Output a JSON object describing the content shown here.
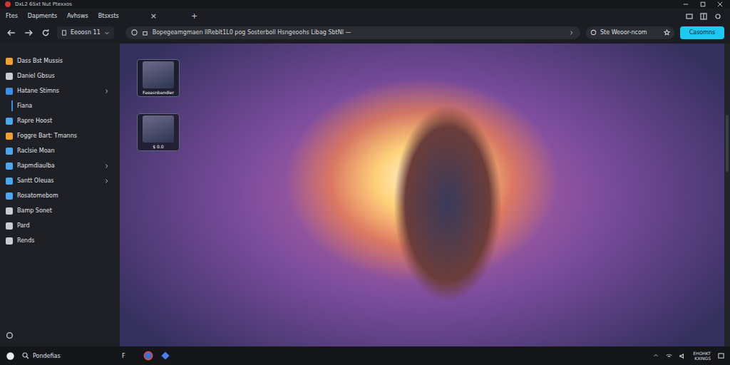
{
  "window": {
    "title": "DxL2 6Sxt Nut Ptexxos"
  },
  "menu": [
    "Ftes",
    "Dapments",
    "Avhsws",
    "Btsxsts"
  ],
  "tab_controls": {
    "close": "×",
    "new": "+"
  },
  "nav": {
    "tab_label": "Eeoosn 11",
    "address": "Bopegeamgmaen llReblt1L0 pog Sosterboll Hsngeoohs Libag SbtNl —",
    "search": "Ste Weoor-ncom",
    "button": "Casomns"
  },
  "sidebar": {
    "items": [
      {
        "label": "Dass Bst Mussis",
        "kind": "item",
        "expandable": false,
        "color": "#f0a030"
      },
      {
        "label": "Daniel Gbsus",
        "kind": "item",
        "expandable": false,
        "color": "#c8ccd4"
      },
      {
        "label": "Hatane Stimns",
        "kind": "item",
        "expandable": true,
        "color": "#3a8ee8"
      },
      {
        "label": "Fiana",
        "kind": "child",
        "expandable": false,
        "color": "#3a8ee8"
      },
      {
        "label": "Rapre Hoost",
        "kind": "item",
        "expandable": false,
        "color": "#4aa8f0"
      },
      {
        "label": "Foggre Bart: Tmanns",
        "kind": "item",
        "expandable": false,
        "color": "#f0a030"
      },
      {
        "label": "Raclsie Moan",
        "kind": "item",
        "expandable": false,
        "color": "#4aa8f0"
      },
      {
        "label": "Rapmdiaulba",
        "kind": "item",
        "expandable": true,
        "color": "#4aa8f0"
      },
      {
        "label": "Santt Oleuas",
        "kind": "item",
        "expandable": true,
        "color": "#4aa8f0"
      },
      {
        "label": "Rosatomebom",
        "kind": "item",
        "expandable": false,
        "color": "#4aa8f0"
      },
      {
        "label": "Bamp Sonet",
        "kind": "item",
        "expandable": false,
        "color": "#c8ccd4"
      },
      {
        "label": "Pard",
        "kind": "item",
        "expandable": false,
        "color": "#c8ccd4"
      },
      {
        "label": "Rends",
        "kind": "item",
        "expandable": false,
        "color": "#c8ccd4"
      }
    ]
  },
  "canvas": {
    "cards": [
      {
        "caption": "Faoasnbandler"
      },
      {
        "caption": "$ 0.0"
      }
    ]
  },
  "taskbar": {
    "search": "Pondefias",
    "key": "F",
    "clock": [
      "EHOHKT",
      "KXINGS"
    ]
  }
}
